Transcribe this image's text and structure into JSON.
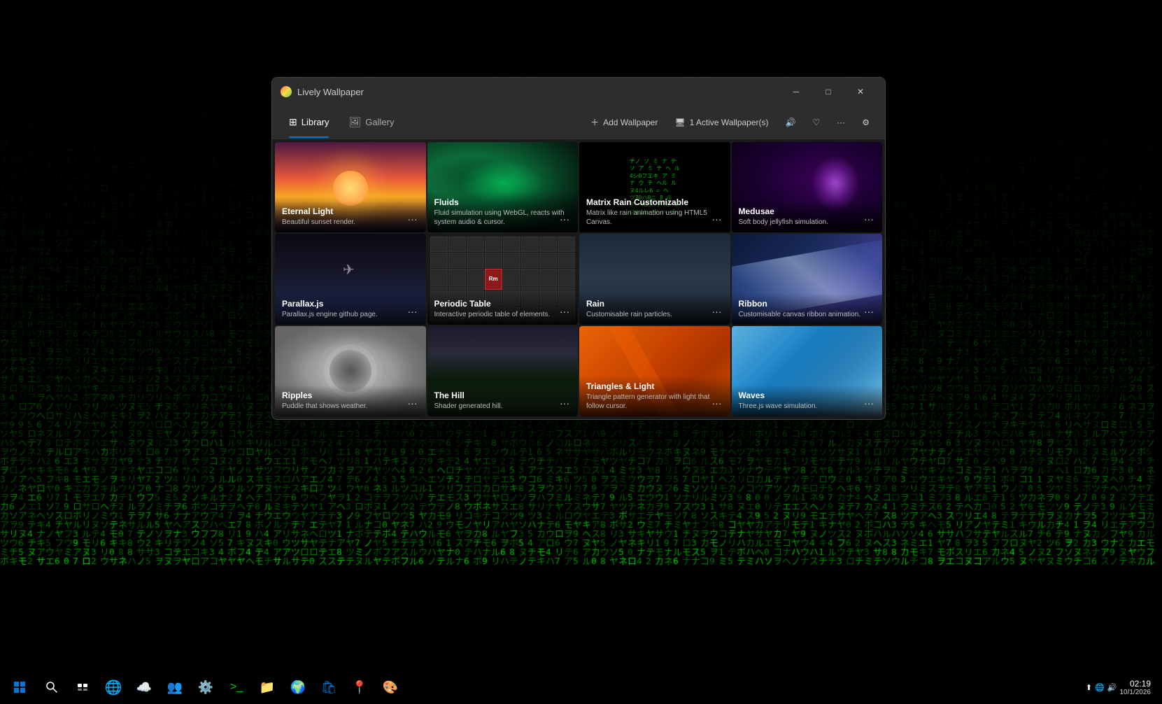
{
  "app": {
    "title": "Lively Wallpaper",
    "icon": "lively-icon"
  },
  "window_controls": {
    "minimize": "─",
    "maximize": "□",
    "close": "✕"
  },
  "nav": {
    "tabs": [
      {
        "id": "library",
        "label": "Library",
        "icon": "library-icon",
        "active": true
      },
      {
        "id": "gallery",
        "label": "Gallery",
        "icon": "gallery-icon",
        "active": false
      }
    ],
    "actions": [
      {
        "id": "add-wallpaper",
        "label": "Add Wallpaper",
        "icon": "plus-icon"
      },
      {
        "id": "active-wallpaper",
        "label": "1 Active Wallpaper(s)",
        "icon": "monitor-icon"
      },
      {
        "id": "volume",
        "icon": "volume-icon"
      },
      {
        "id": "favorites",
        "icon": "heart-icon"
      },
      {
        "id": "more",
        "icon": "more-icon"
      },
      {
        "id": "settings",
        "icon": "settings-icon"
      }
    ]
  },
  "wallpapers": [
    {
      "id": "eternal-light",
      "title": "Eternal Light",
      "description": "Beautiful sunset render.",
      "thumb": "eternal"
    },
    {
      "id": "fluids",
      "title": "Fluids",
      "description": "Fluid simulation using WebGL, reacts with system audio & cursor.",
      "thumb": "fluids"
    },
    {
      "id": "matrix-rain",
      "title": "Matrix Rain Customizable",
      "description": "Matrix like rain animation using HTML5 Canvas.",
      "thumb": "matrix"
    },
    {
      "id": "medusae",
      "title": "Medusae",
      "description": "Soft body jellyfish simulation.",
      "thumb": "medusae"
    },
    {
      "id": "parallax-js",
      "title": "Parallax.js",
      "description": "Parallax.js engine github page.",
      "thumb": "parallax"
    },
    {
      "id": "periodic-table",
      "title": "Periodic Table",
      "description": "Interactive periodic table of elements.",
      "thumb": "periodic"
    },
    {
      "id": "rain",
      "title": "Rain",
      "description": "Customisable rain particles.",
      "thumb": "rain"
    },
    {
      "id": "ribbon",
      "title": "Ribbon",
      "description": "Customisable canvas ribbon animation.",
      "thumb": "ribbon"
    },
    {
      "id": "ripples",
      "title": "Ripples",
      "description": "Puddle that shows weather.",
      "thumb": "ripples"
    },
    {
      "id": "the-hill",
      "title": "The Hill",
      "description": "Shader generated hill.",
      "thumb": "hill"
    },
    {
      "id": "triangles-light",
      "title": "Triangles & Light",
      "description": "Triangle pattern generator with light that follow cursor.",
      "thumb": "triangles"
    },
    {
      "id": "waves",
      "title": "Waves",
      "description": "Three.js wave simulation.",
      "thumb": "waves"
    }
  ],
  "taskbar": {
    "start_label": "Start",
    "icons": [
      "search-icon",
      "taskview-icon",
      "edge-icon",
      "weather-icon",
      "teams-icon",
      "settings-icon",
      "terminal-icon",
      "explorer-icon",
      "chrome-icon",
      "store-icon",
      "maps-icon",
      "color-icon"
    ]
  },
  "matrix_columns": [
    "チノ\nソ\n4\nシ\n0\nフ\nエ\nキ",
    "ヤ\n4\n4\n4",
    "ミ\nヌ\n\n\nウ\nハ\n0\nニ",
    "ナ\nウ\n\n\nル\n1\n2\n",
    "テ\n\n\nヘ\n=\nレ\nヘ\n8",
    "ソ\n\nシ\n0\nフ\nエ\n",
    "ア\nミ\n\n\nツ\n70\nハ\n0",
    "ナ\n\n\nヌ\n4\nル\nレ\n6",
    "テ\nヘ\n\nル\n=\nヘ\n",
    "ソ\nユ\n\nア\nヘ\n8\nゾ\n",
    "ミ\n\nシ\n0\nフ\nエ\n",
    "ナ\n4\n\nヌ\n4\nル\n",
    "ア\n\nミ\n\n\nツ\nツ\n",
    "テ\nヘ\n\nル\nル\n=\n",
    "ソ\nユ\nア\nア\nヘ\n8\n",
    "ミ\n\nシ\n\n0\nフ\n"
  ]
}
